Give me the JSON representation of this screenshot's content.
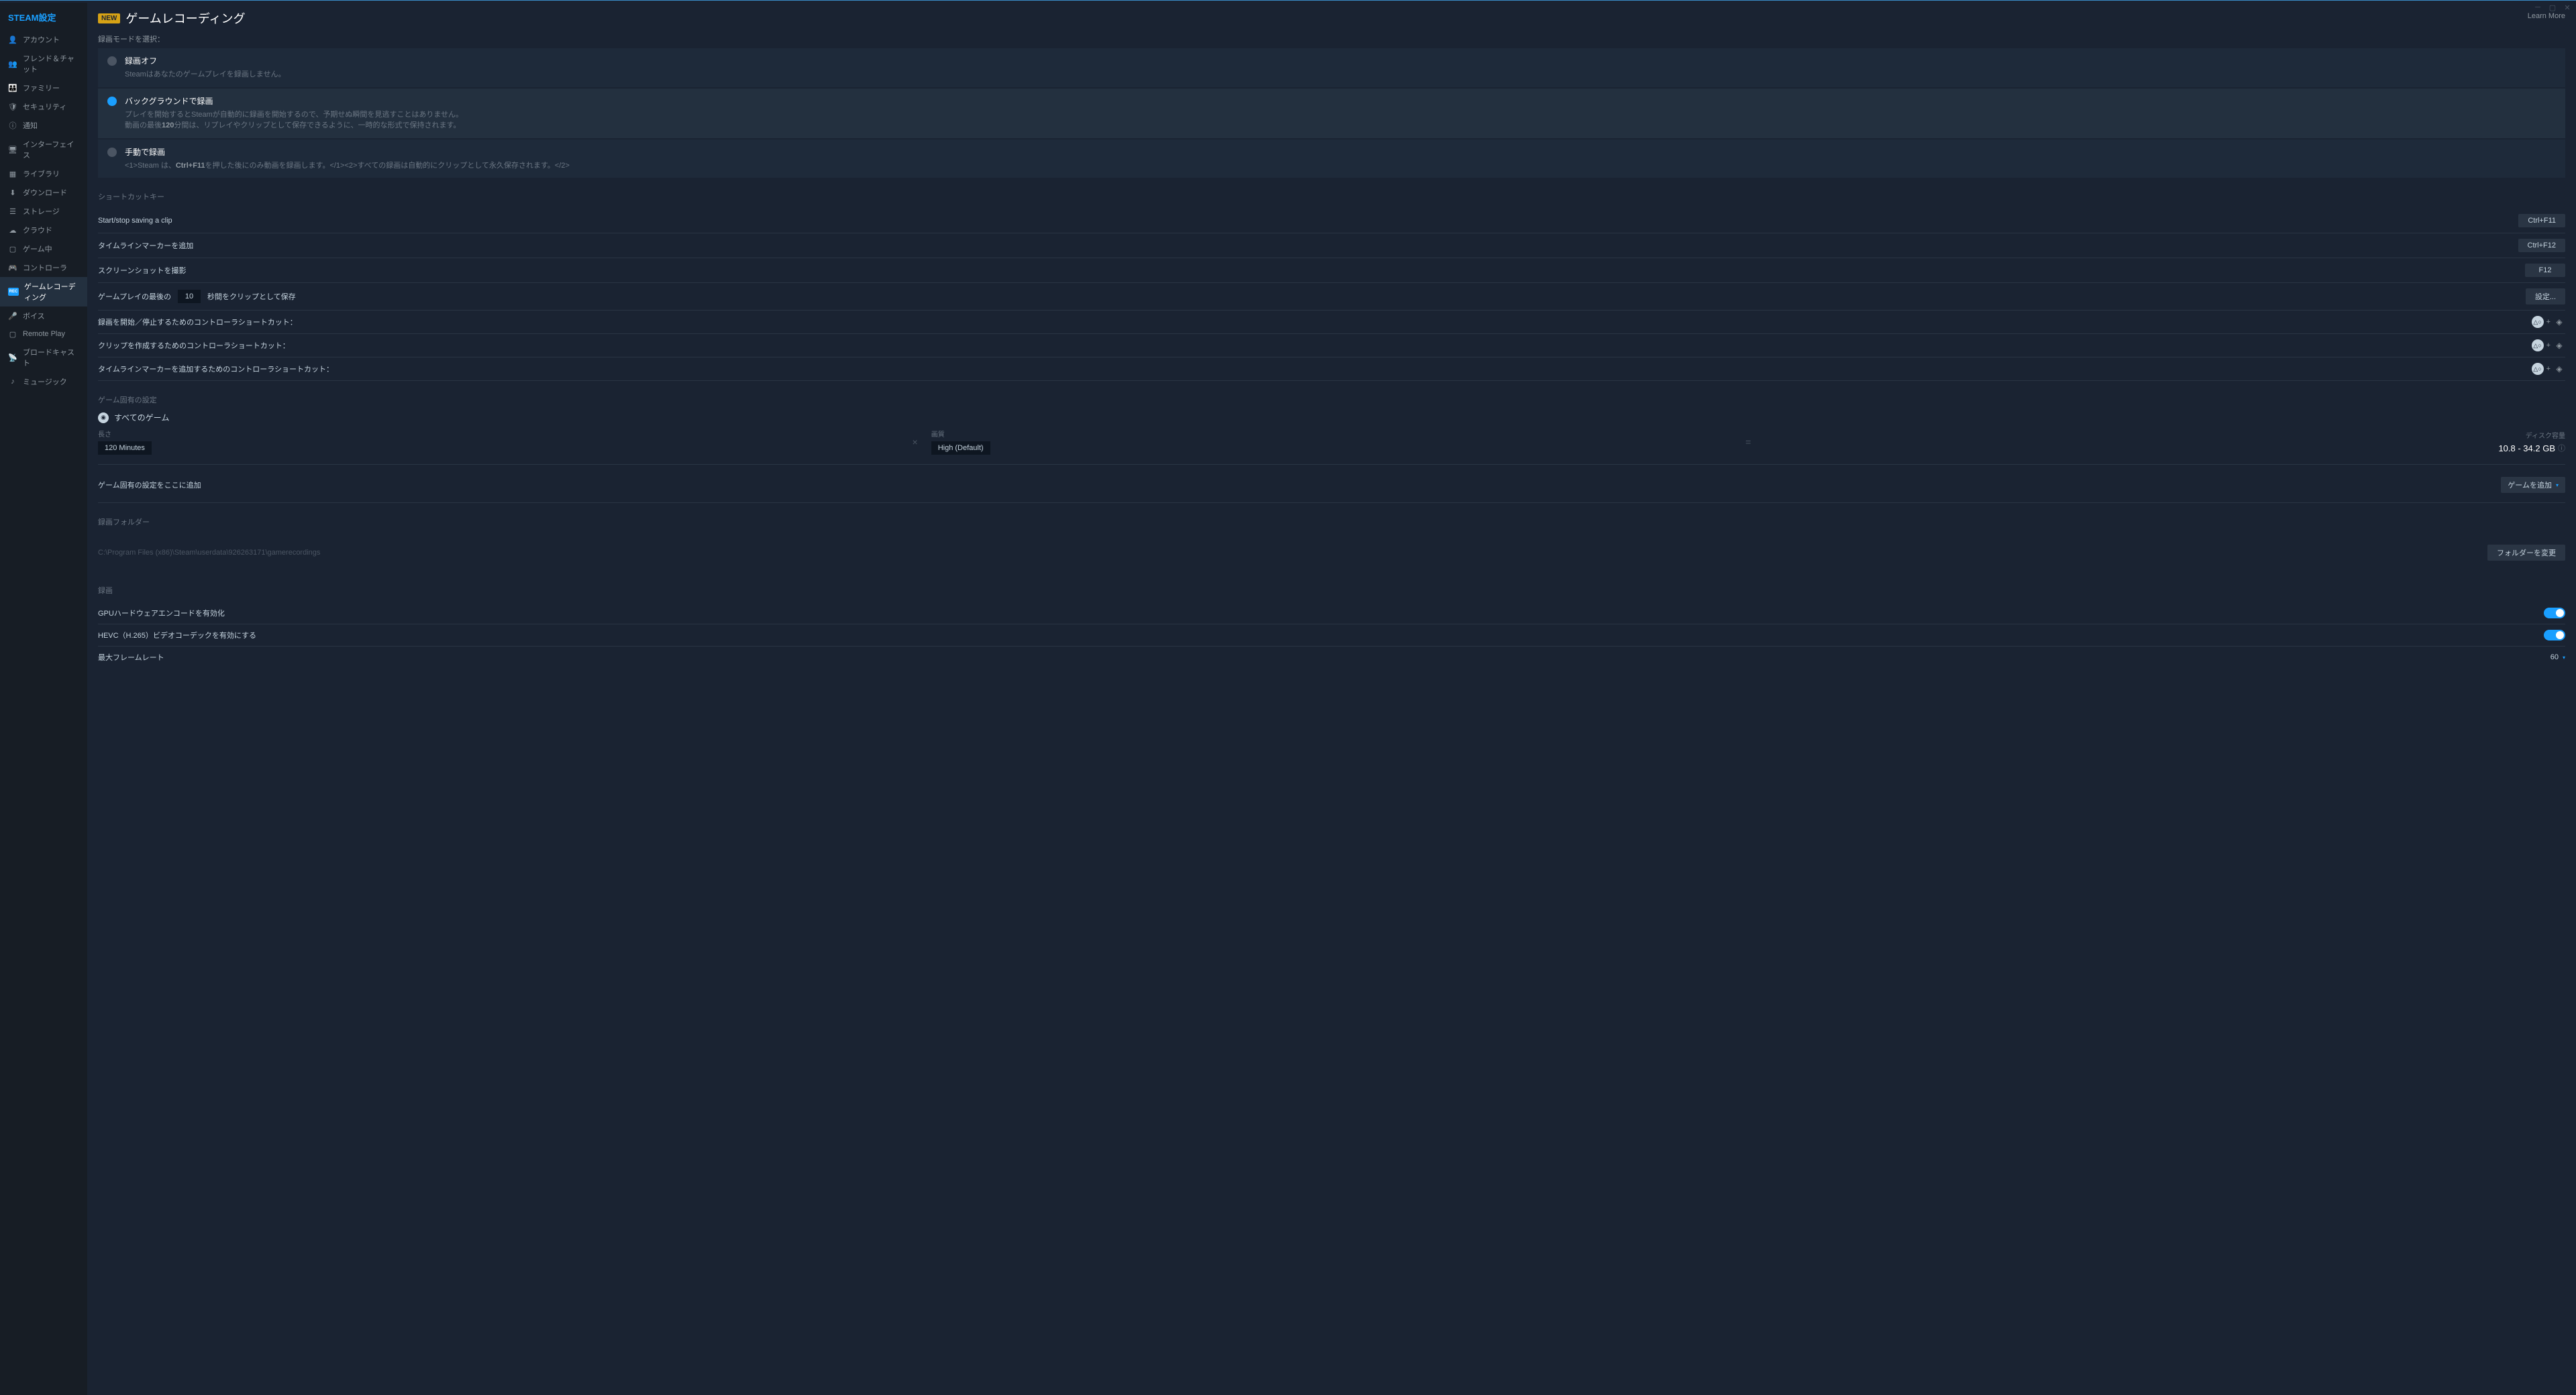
{
  "app": {
    "title": "STEAM設定"
  },
  "sidebar": {
    "items": [
      {
        "icon": "👤",
        "name": "account",
        "label": "アカウント"
      },
      {
        "icon": "👥",
        "name": "friends-chat",
        "label": "フレンド＆チャット"
      },
      {
        "icon": "👪",
        "name": "family",
        "label": "ファミリー"
      },
      {
        "icon": "🛡",
        "name": "security",
        "label": "セキュリティ"
      },
      {
        "icon": "ⓘ",
        "name": "notifications",
        "label": "通知"
      },
      {
        "icon": "🖥",
        "name": "interface",
        "label": "インターフェイス"
      },
      {
        "icon": "▦",
        "name": "library",
        "label": "ライブラリ"
      },
      {
        "icon": "⬇",
        "name": "downloads",
        "label": "ダウンロード"
      },
      {
        "icon": "☰",
        "name": "storage",
        "label": "ストレージ"
      },
      {
        "icon": "☁",
        "name": "cloud",
        "label": "クラウド"
      },
      {
        "icon": "▢",
        "name": "in-game",
        "label": "ゲーム中"
      },
      {
        "icon": "🎮",
        "name": "controller",
        "label": "コントローラ"
      },
      {
        "icon": "REC",
        "name": "game-recording",
        "label": "ゲームレコーディング",
        "active": true
      },
      {
        "icon": "🎤",
        "name": "voice",
        "label": "ボイス"
      },
      {
        "icon": "▢",
        "name": "remote-play",
        "label": "Remote Play"
      },
      {
        "icon": "📡",
        "name": "broadcast",
        "label": "ブロードキャスト"
      },
      {
        "icon": "♪",
        "name": "music",
        "label": "ミュージック"
      }
    ]
  },
  "header": {
    "new_badge": "NEW",
    "title": "ゲームレコーディング",
    "learn_more": "Learn More"
  },
  "record_mode": {
    "label": "録画モードを選択：",
    "options": [
      {
        "title": "録画オフ",
        "desc": "Steamはあなたのゲームプレイを録画しません。"
      },
      {
        "title": "バックグラウンドで録画",
        "desc_line1": "プレイを開始するとSteamが自動的に録画を開始するので、予期せぬ瞬間を見逃すことはありません。",
        "desc_line2_prefix": "動画の最後",
        "desc_line2_bold": "120",
        "desc_line2_suffix": "分間は、リプレイやクリップとして保存できるように、一時的な形式で保持されます。",
        "selected": true
      },
      {
        "title": "手動で録画",
        "desc_prefix": "<1>Steam は、",
        "desc_bold": "Ctrl+F11",
        "desc_suffix": "を押した後にのみ動画を録画します。</1><2>すべての録画は自動的にクリップとして永久保存されます。</2>"
      }
    ]
  },
  "shortcuts": {
    "header": "ショートカットキー",
    "rows": [
      {
        "label": "Start/stop saving a clip",
        "binding": "Ctrl+F11"
      },
      {
        "label": "タイムラインマーカーを追加",
        "binding": "Ctrl+F12"
      },
      {
        "label": "スクリーンショットを撮影",
        "binding": "F12"
      }
    ],
    "clip_last": {
      "prefix": "ゲームプレイの最後の",
      "value": "10",
      "suffix": "秒間をクリップとして保存",
      "button": "設定..."
    },
    "controller_rows": [
      {
        "label": "録画を開始／停止するためのコントローラショートカット："
      },
      {
        "label": "クリップを作成するためのコントローラショートカット："
      },
      {
        "label": "タイムラインマーカーを追加するためのコントローラショートカット："
      }
    ]
  },
  "game_specific": {
    "header": "ゲーム固有の設定",
    "all_games": "すべてのゲーム",
    "length_label": "長さ",
    "length_value": "120 Minutes",
    "quality_label": "画質",
    "quality_value": "High (Default)",
    "disk_label": "ディスク容量",
    "disk_value": "10.8 - 34.2 GB",
    "add_row_label": "ゲーム固有の設定をここに追加",
    "add_button": "ゲームを追加"
  },
  "folder": {
    "header": "録画フォルダー",
    "path": "C:\\Program Files (x86)\\Steam\\userdata\\926263171\\gamerecordings",
    "change_button": "フォルダーを変更"
  },
  "recording": {
    "header": "録画",
    "gpu_encode": "GPUハードウェアエンコードを有効化",
    "hevc": "HEVC（H.265）ビデオコーデックを有効にする",
    "max_fps_label": "最大フレームレート",
    "max_fps_value": "60"
  }
}
